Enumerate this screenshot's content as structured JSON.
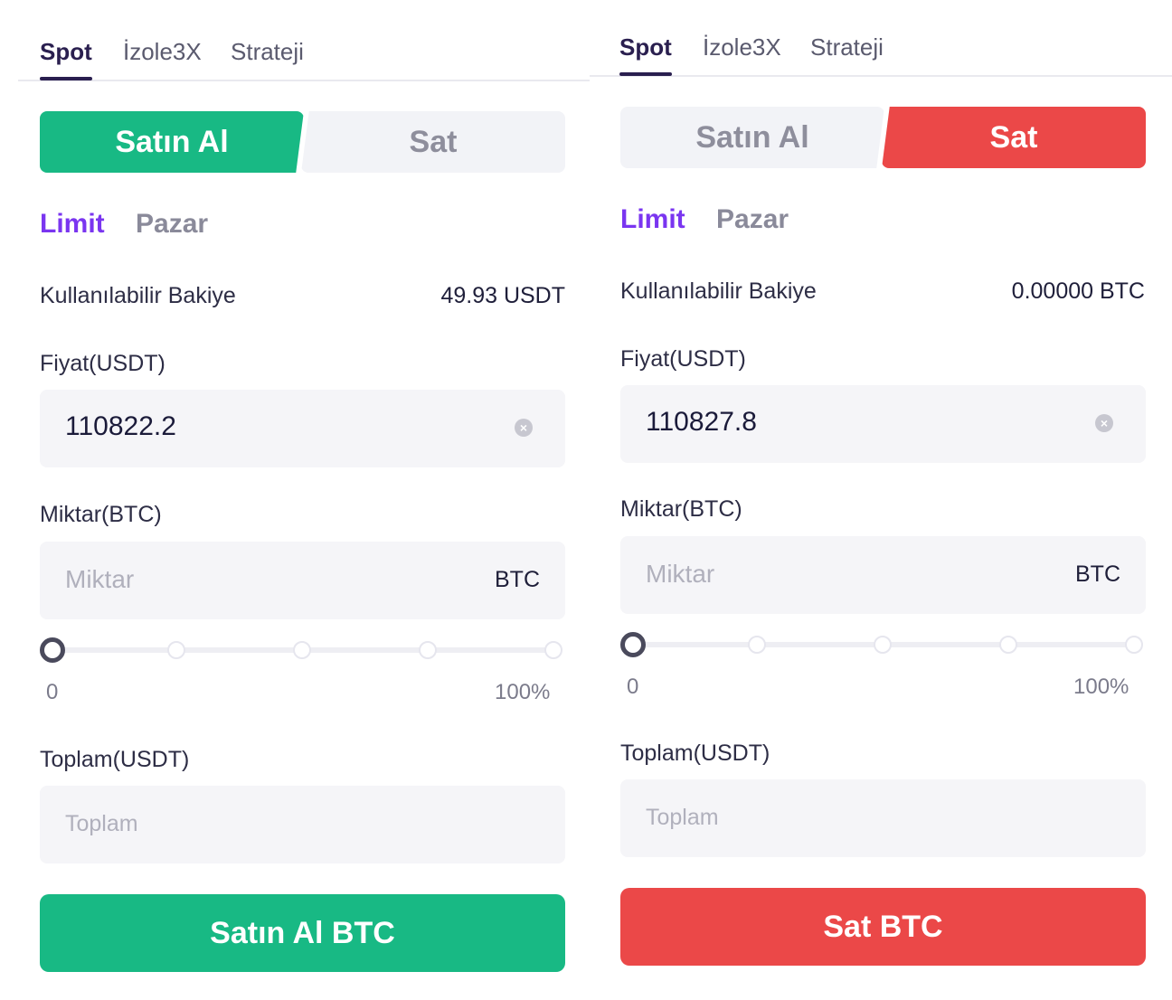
{
  "colors": {
    "buy": "#18b984",
    "sell": "#eb4848",
    "active_order_type": "#7a35f0",
    "active_tab": "#2a1f4f"
  },
  "buy_panel": {
    "tabs": [
      "Spot",
      "İzole3X",
      "Strateji"
    ],
    "active_tab": "Spot",
    "side_buy_label": "Satın Al",
    "side_sell_label": "Sat",
    "active_side": "Satın Al",
    "order_types": [
      "Limit",
      "Pazar"
    ],
    "active_order_type": "Limit",
    "balance_label": "Kullanılabilir Bakiye",
    "balance_value": "49.93 USDT",
    "price_label": "Fiyat(USDT)",
    "price_value": "110822.2",
    "clear_icon": "clear-circle-icon",
    "amount_label": "Miktar(BTC)",
    "amount_placeholder": "Miktar",
    "amount_unit": "BTC",
    "slider_min_label": "0",
    "slider_max_label": "100%",
    "slider_value_percent": 0,
    "total_label": "Toplam(USDT)",
    "total_placeholder": "Toplam",
    "submit_label": "Satın Al BTC"
  },
  "sell_panel": {
    "tabs": [
      "Spot",
      "İzole3X",
      "Strateji"
    ],
    "active_tab": "Spot",
    "side_buy_label": "Satın Al",
    "side_sell_label": "Sat",
    "active_side": "Sat",
    "order_types": [
      "Limit",
      "Pazar"
    ],
    "active_order_type": "Limit",
    "balance_label": "Kullanılabilir Bakiye",
    "balance_value": "0.00000 BTC",
    "price_label": "Fiyat(USDT)",
    "price_value": "110827.8",
    "clear_icon": "clear-circle-icon",
    "amount_label": "Miktar(BTC)",
    "amount_placeholder": "Miktar",
    "amount_unit": "BTC",
    "slider_min_label": "0",
    "slider_max_label": "100%",
    "slider_value_percent": 0,
    "total_label": "Toplam(USDT)",
    "total_placeholder": "Toplam",
    "submit_label": "Sat BTC"
  }
}
